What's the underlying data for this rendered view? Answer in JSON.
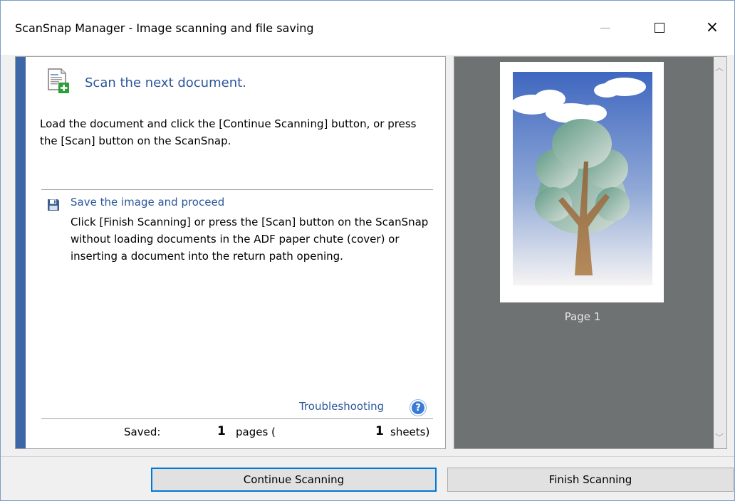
{
  "window": {
    "title": "ScanSnap Manager - Image scanning and file saving",
    "controls": {
      "minimize": "minimize",
      "maximize": "maximize",
      "close": "×"
    }
  },
  "main": {
    "heading": "Scan the next document.",
    "description": "Load the document and click the [Continue Scanning] button, or press the [Scan] button on the ScanSnap.",
    "save_section": {
      "title": "Save the image and proceed",
      "description": "Click [Finish Scanning] or press the [Scan] button on the ScanSnap without loading documents in the ADF paper chute (cover) or inserting a document into the return path opening."
    },
    "troubleshooting_link": "Troubleshooting",
    "help_icon_glyph": "?",
    "status": {
      "saved_label": "Saved:",
      "pages_count": "1",
      "pages_unit": "pages (",
      "sheets_count": "1",
      "sheets_unit": "sheets)"
    }
  },
  "preview": {
    "page_label": "Page 1",
    "scroll_up_glyph": "︿",
    "scroll_down_glyph": "﹀"
  },
  "buttons": {
    "continue": "Continue Scanning",
    "finish": "Finish Scanning"
  },
  "colors": {
    "accent": "#3d66a8",
    "link": "#2b579a",
    "preview_bg": "#6e7272",
    "focus_border": "#0078d7"
  }
}
